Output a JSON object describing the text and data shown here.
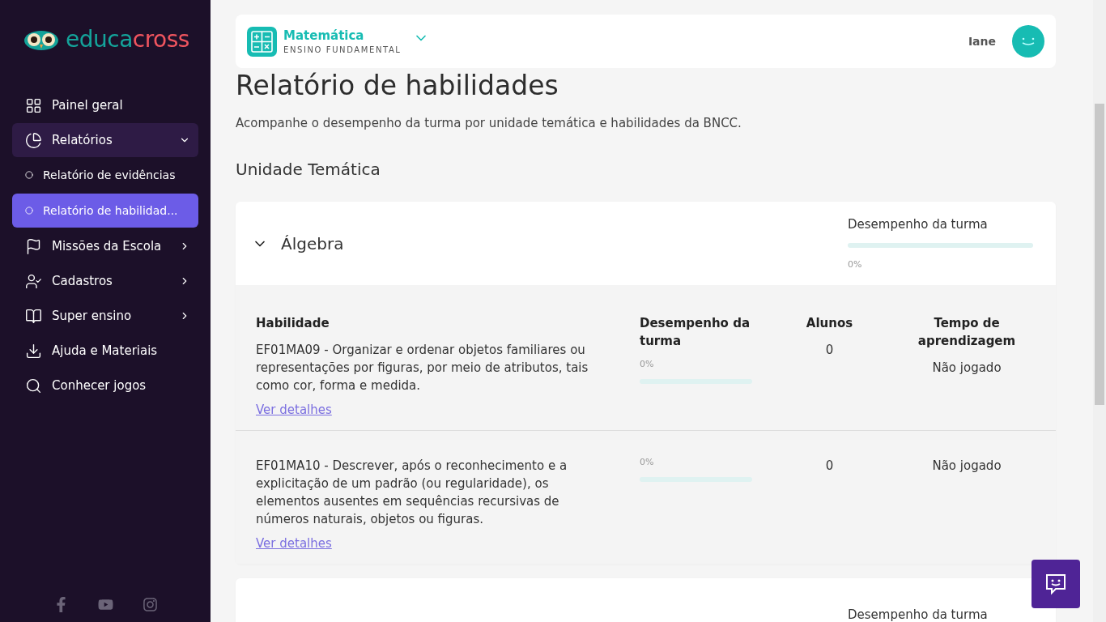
{
  "logo": {
    "first": "educa",
    "second": "cross"
  },
  "sidebar": {
    "items": [
      {
        "label": "Painel geral"
      },
      {
        "label": "Relatórios",
        "expanded": true,
        "children": [
          {
            "label": "Relatório de evidências",
            "selected": false
          },
          {
            "label": "Relatório de habilidad...",
            "selected": true
          }
        ]
      },
      {
        "label": "Missões da Escola",
        "expanded": false
      },
      {
        "label": "Cadastros",
        "expanded": false
      },
      {
        "label": "Super ensino",
        "expanded": false
      },
      {
        "label": "Ajuda e Materiais"
      },
      {
        "label": "Conhecer jogos"
      }
    ]
  },
  "subject_bar": {
    "subject": "Matemática",
    "level": "ENSINO FUNDAMENTAL",
    "user": "Iane"
  },
  "page": {
    "title": "Relatório de habilidades",
    "subtitle": "Acompanhe o desempenho da turma por unidade temática e habilidades da BNCC.",
    "section": "Unidade Temática"
  },
  "units": [
    {
      "name": "Álgebra",
      "expanded": true,
      "performance_label": "Desempenho da turma",
      "level": 0,
      "reading": "0%",
      "columns": [
        "Habilidade",
        "Desempenho da turma",
        "Alunos",
        "Tempo de aprendizagem"
      ],
      "skills": [
        {
          "description": "EF01MA09 - Organizar e ordenar objetos familiares ou representações por figuras, por meio de atributos, tais como cor, forma e medida.",
          "reading": "0%",
          "level": 0,
          "students": "0",
          "time": "Não jogado",
          "link": "Ver detalhes"
        },
        {
          "description": "EF01MA10 - Descrever, após o reconhecimento e a explicitação de um padrão (ou regularidade), os elementos ausentes em sequências recursivas de números naturais, objetos ou figuras.",
          "reading": "0%",
          "level": 0,
          "students": "0",
          "time": "Não jogado",
          "link": "Ver detalhes"
        }
      ]
    },
    {
      "performance_label": "Desempenho da turma"
    }
  ]
}
